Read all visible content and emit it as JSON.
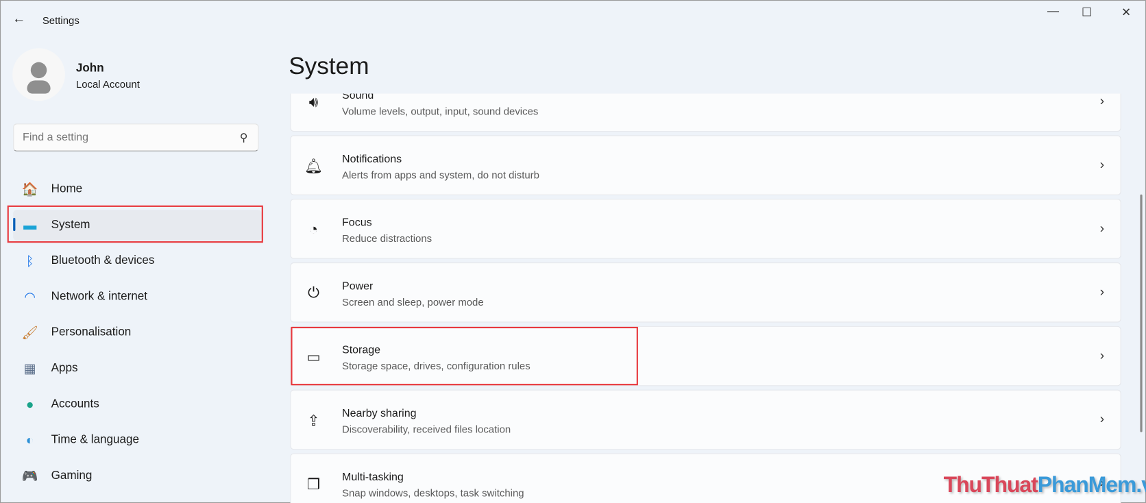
{
  "window": {
    "title": "Settings",
    "back": "←",
    "minimize": "—",
    "maximize": "☐",
    "close": "✕"
  },
  "user": {
    "name": "John",
    "type": "Local Account"
  },
  "search": {
    "placeholder": "Find a setting",
    "icon": "⚲"
  },
  "sidebar": {
    "items": [
      {
        "label": "Home",
        "icon": "home-icon",
        "glyph": "🏠"
      },
      {
        "label": "System",
        "icon": "system-icon",
        "glyph": "▬"
      },
      {
        "label": "Bluetooth & devices",
        "icon": "bluetooth-icon",
        "glyph": "ᛒ"
      },
      {
        "label": "Network & internet",
        "icon": "wifi-icon",
        "glyph": "◠"
      },
      {
        "label": "Personalisation",
        "icon": "brush-icon",
        "glyph": "🖌"
      },
      {
        "label": "Apps",
        "icon": "apps-icon",
        "glyph": "▦"
      },
      {
        "label": "Accounts",
        "icon": "accounts-icon",
        "glyph": "●"
      },
      {
        "label": "Time & language",
        "icon": "globe-clock-icon",
        "glyph": "◐"
      },
      {
        "label": "Gaming",
        "icon": "gamepad-icon",
        "glyph": "🎮"
      }
    ]
  },
  "main": {
    "title": "System",
    "cards": [
      {
        "title": "Sound",
        "subtitle": "Volume levels, output, input, sound devices",
        "glyph": "🔊︎"
      },
      {
        "title": "Notifications",
        "subtitle": "Alerts from apps and system, do not disturb",
        "glyph": "🔔︎"
      },
      {
        "title": "Focus",
        "subtitle": "Reduce distractions",
        "glyph": "◔"
      },
      {
        "title": "Power",
        "subtitle": "Screen and sleep, power mode",
        "glyph": "⏻"
      },
      {
        "title": "Storage",
        "subtitle": "Storage space, drives, configuration rules",
        "glyph": "▭"
      },
      {
        "title": "Nearby sharing",
        "subtitle": "Discoverability, received files location",
        "glyph": "⇪"
      },
      {
        "title": "Multi-tasking",
        "subtitle": "Snap windows, desktops, task switching",
        "glyph": "❐"
      }
    ],
    "chevron": "›"
  },
  "watermark": {
    "part1": "ThuThuat",
    "part2": "PhanMem",
    "part3": ".vn"
  },
  "colors": {
    "accent": "#005fb8",
    "highlight": "#e8383d"
  }
}
